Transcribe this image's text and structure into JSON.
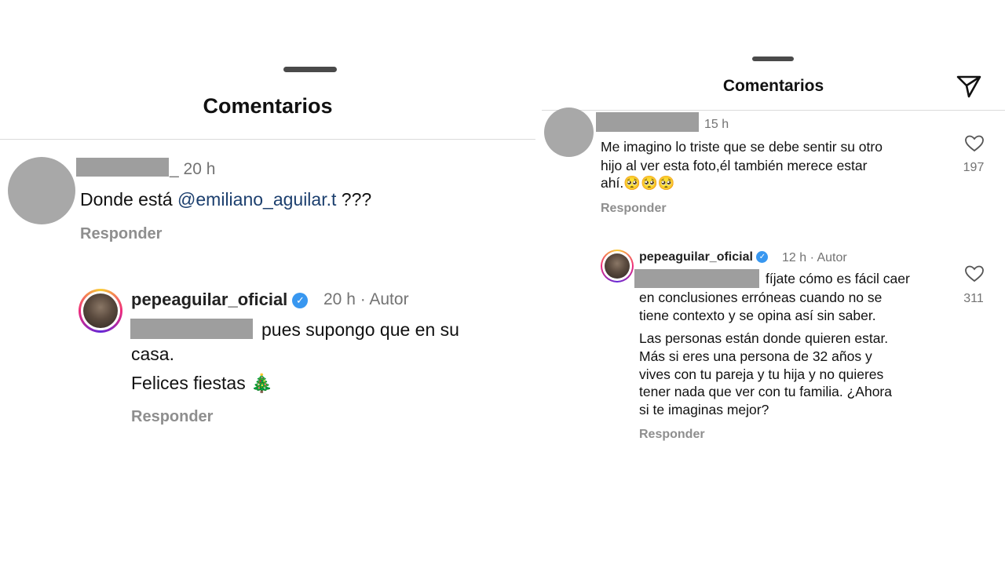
{
  "left": {
    "title": "Comentarios",
    "comment": {
      "time": "_ 20 h",
      "text_prefix": "Donde está ",
      "mention": "@emiliano_aguilar.t",
      "text_suffix": " ???",
      "reply": "Responder"
    },
    "author_reply": {
      "username": "pepeaguilar_oficial",
      "verified_glyph": "✓",
      "meta": "20 h · Autor",
      "line1": "pues supongo que en su",
      "line2": "casa.",
      "line3": "Felices fiestas 🎄",
      "reply": "Responder"
    }
  },
  "right": {
    "title": "Comentarios",
    "send_icon": "send-icon",
    "comment": {
      "time": "15 h",
      "line1": "Me imagino lo triste que se debe sentir su otro",
      "line2": "hijo al ver esta foto,él también merece estar",
      "line3": "ahí.🥺🥺🥺",
      "reply": "Responder",
      "likes": "197"
    },
    "author_reply": {
      "username": "pepeaguilar_oficial",
      "verified_glyph": "✓",
      "meta": "12 h · Autor",
      "p1_line1": "fíjate cómo es fácil caer",
      "p1_line2": "en conclusiones erróneas cuando no se",
      "p1_line3": "tiene contexto y se opina así sin saber.",
      "p2_line1": "Las personas están donde quieren estar.",
      "p2_line2": "Más si eres una persona de 32 años y",
      "p2_line3": "vives con tu pareja y tu hija y no quieres",
      "p2_line4": "tener nada que ver con tu familia. ¿Ahora",
      "p2_line5": "si te imaginas mejor?",
      "reply": "Responder",
      "likes": "311"
    }
  },
  "colors": {
    "mention": "#1c3f6e",
    "verified": "#3897f0",
    "muted": "#737373"
  }
}
